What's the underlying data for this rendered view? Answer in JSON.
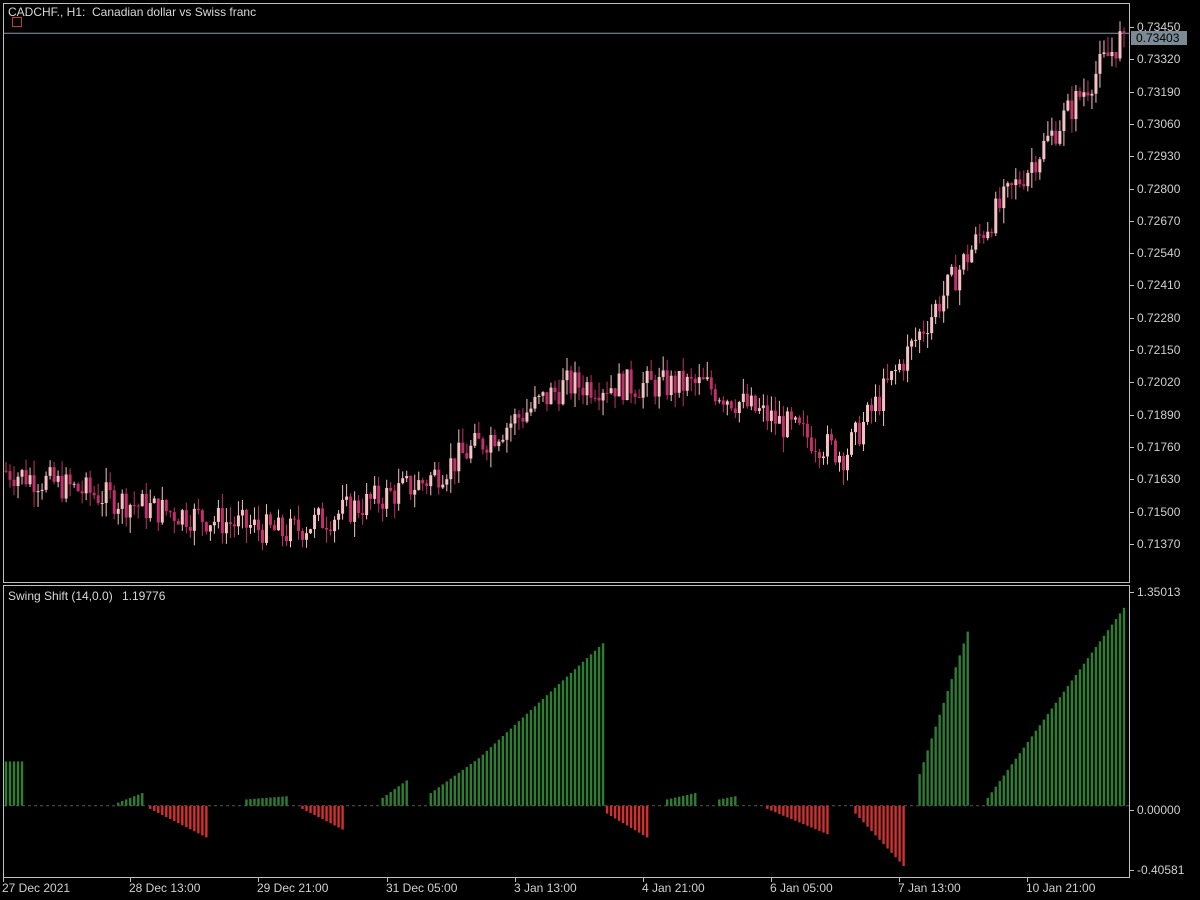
{
  "window": {
    "chart_title": "CADCHF., H1:  Canadian dollar vs Swiss franc",
    "indicator_title": "Swing Shift (14,0.0)",
    "indicator_value": "1.19776",
    "current_price": "0.73403"
  },
  "price_axis": [
    "0.73450",
    "0.73320",
    "0.73190",
    "0.73060",
    "0.72930",
    "0.72800",
    "0.72670",
    "0.72540",
    "0.72410",
    "0.72280",
    "0.72150",
    "0.72020",
    "0.71890",
    "0.71760",
    "0.71630",
    "0.71500",
    "0.71370"
  ],
  "indicator_axis": [
    "1.35013",
    "0.00000",
    "-0.40581"
  ],
  "time_axis": [
    "27 Dec 2021",
    "28 Dec 13:00",
    "29 Dec 21:00",
    "31 Dec 05:00",
    "3 Jan 13:00",
    "4 Jan 21:00",
    "6 Jan 05:00",
    "7 Jan 13:00",
    "10 Jan 21:00"
  ],
  "colors": {
    "background": "#000000",
    "bull_candle": "#f4c2c2",
    "bear_candle": "#c0306a",
    "hist_up": "#2e7d32",
    "hist_down": "#d32f2f",
    "grid_line": "#c0c0c0",
    "price_line": "#8a9aa5"
  },
  "chart_data": [
    {
      "type": "line",
      "title": "CADCHF., H1:  Canadian dollar vs Swiss franc",
      "ylim": [
        0.713,
        0.735
      ],
      "x": [
        "27 Dec 2021",
        "28 Dec 13:00",
        "29 Dec 21:00",
        "31 Dec 05:00",
        "3 Jan 13:00",
        "4 Jan 21:00",
        "6 Jan 05:00",
        "7 Jan 13:00",
        "10 Jan 21:00"
      ],
      "series": [
        {
          "values": [
            0.7172,
            0.7158,
            0.7148,
            0.7168,
            0.7205,
            0.7205,
            0.7178,
            0.7265,
            0.734
          ]
        }
      ],
      "last": 0.73403
    },
    {
      "type": "bar",
      "title": "Swing Shift (14,0.0)",
      "ylim": [
        -0.40581,
        1.35013
      ],
      "last": 1.19776
    }
  ]
}
